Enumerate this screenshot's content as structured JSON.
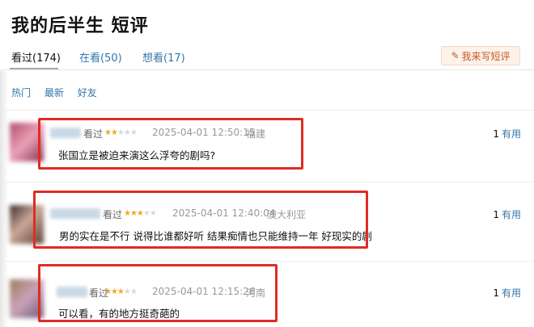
{
  "page": {
    "title": "我的后半生 短评"
  },
  "tabs": [
    {
      "label": "看过(174)"
    },
    {
      "label": "在看(50)"
    },
    {
      "label": "想看(17)"
    }
  ],
  "write_button": {
    "label": "我来写短评",
    "icon": "pencil-icon"
  },
  "filters": [
    {
      "label": "热门"
    },
    {
      "label": "最新"
    },
    {
      "label": "好友"
    }
  ],
  "comments": [
    {
      "status": "看过",
      "rating": 2,
      "time": "2025-04-01 12:50:15",
      "location": "福建",
      "text": "张国立是被迫来演这么浮夸的剧吗?",
      "useful_count": "1",
      "useful_label": "有用"
    },
    {
      "status": "看过",
      "rating": 3,
      "time": "2025-04-01 12:40:04",
      "location": "澳大利亚",
      "text": "男的实在是不行 说得比谁都好听 结果痴情也只能维持一年 好现实的剧",
      "useful_count": "1",
      "useful_label": "有用"
    },
    {
      "status": "看过",
      "rating": 3,
      "time": "2025-04-01 12:15:26",
      "location": "河南",
      "text": "可以看，有的地方挺奇葩的",
      "useful_count": "1",
      "useful_label": "有用"
    }
  ],
  "colors": {
    "link": "#3377aa",
    "star": "#f5a623",
    "highlight_box": "#e02c24"
  }
}
